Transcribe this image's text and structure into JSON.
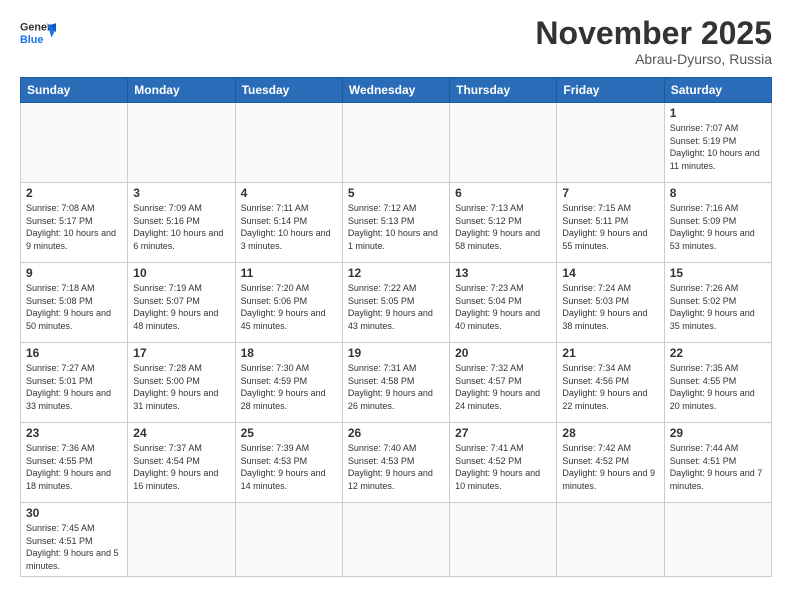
{
  "logo": {
    "general": "General",
    "blue": "Blue"
  },
  "header": {
    "month": "November 2025",
    "location": "Abrau-Dyurso, Russia"
  },
  "weekdays": [
    "Sunday",
    "Monday",
    "Tuesday",
    "Wednesday",
    "Thursday",
    "Friday",
    "Saturday"
  ],
  "weeks": [
    [
      {
        "day": "",
        "info": ""
      },
      {
        "day": "",
        "info": ""
      },
      {
        "day": "",
        "info": ""
      },
      {
        "day": "",
        "info": ""
      },
      {
        "day": "",
        "info": ""
      },
      {
        "day": "",
        "info": ""
      },
      {
        "day": "1",
        "info": "Sunrise: 7:07 AM\nSunset: 5:19 PM\nDaylight: 10 hours\nand 11 minutes."
      }
    ],
    [
      {
        "day": "2",
        "info": "Sunrise: 7:08 AM\nSunset: 5:17 PM\nDaylight: 10 hours\nand 9 minutes."
      },
      {
        "day": "3",
        "info": "Sunrise: 7:09 AM\nSunset: 5:16 PM\nDaylight: 10 hours\nand 6 minutes."
      },
      {
        "day": "4",
        "info": "Sunrise: 7:11 AM\nSunset: 5:14 PM\nDaylight: 10 hours\nand 3 minutes."
      },
      {
        "day": "5",
        "info": "Sunrise: 7:12 AM\nSunset: 5:13 PM\nDaylight: 10 hours\nand 1 minute."
      },
      {
        "day": "6",
        "info": "Sunrise: 7:13 AM\nSunset: 5:12 PM\nDaylight: 9 hours\nand 58 minutes."
      },
      {
        "day": "7",
        "info": "Sunrise: 7:15 AM\nSunset: 5:11 PM\nDaylight: 9 hours\nand 55 minutes."
      },
      {
        "day": "8",
        "info": "Sunrise: 7:16 AM\nSunset: 5:09 PM\nDaylight: 9 hours\nand 53 minutes."
      }
    ],
    [
      {
        "day": "9",
        "info": "Sunrise: 7:18 AM\nSunset: 5:08 PM\nDaylight: 9 hours\nand 50 minutes."
      },
      {
        "day": "10",
        "info": "Sunrise: 7:19 AM\nSunset: 5:07 PM\nDaylight: 9 hours\nand 48 minutes."
      },
      {
        "day": "11",
        "info": "Sunrise: 7:20 AM\nSunset: 5:06 PM\nDaylight: 9 hours\nand 45 minutes."
      },
      {
        "day": "12",
        "info": "Sunrise: 7:22 AM\nSunset: 5:05 PM\nDaylight: 9 hours\nand 43 minutes."
      },
      {
        "day": "13",
        "info": "Sunrise: 7:23 AM\nSunset: 5:04 PM\nDaylight: 9 hours\nand 40 minutes."
      },
      {
        "day": "14",
        "info": "Sunrise: 7:24 AM\nSunset: 5:03 PM\nDaylight: 9 hours\nand 38 minutes."
      },
      {
        "day": "15",
        "info": "Sunrise: 7:26 AM\nSunset: 5:02 PM\nDaylight: 9 hours\nand 35 minutes."
      }
    ],
    [
      {
        "day": "16",
        "info": "Sunrise: 7:27 AM\nSunset: 5:01 PM\nDaylight: 9 hours\nand 33 minutes."
      },
      {
        "day": "17",
        "info": "Sunrise: 7:28 AM\nSunset: 5:00 PM\nDaylight: 9 hours\nand 31 minutes."
      },
      {
        "day": "18",
        "info": "Sunrise: 7:30 AM\nSunset: 4:59 PM\nDaylight: 9 hours\nand 28 minutes."
      },
      {
        "day": "19",
        "info": "Sunrise: 7:31 AM\nSunset: 4:58 PM\nDaylight: 9 hours\nand 26 minutes."
      },
      {
        "day": "20",
        "info": "Sunrise: 7:32 AM\nSunset: 4:57 PM\nDaylight: 9 hours\nand 24 minutes."
      },
      {
        "day": "21",
        "info": "Sunrise: 7:34 AM\nSunset: 4:56 PM\nDaylight: 9 hours\nand 22 minutes."
      },
      {
        "day": "22",
        "info": "Sunrise: 7:35 AM\nSunset: 4:55 PM\nDaylight: 9 hours\nand 20 minutes."
      }
    ],
    [
      {
        "day": "23",
        "info": "Sunrise: 7:36 AM\nSunset: 4:55 PM\nDaylight: 9 hours\nand 18 minutes."
      },
      {
        "day": "24",
        "info": "Sunrise: 7:37 AM\nSunset: 4:54 PM\nDaylight: 9 hours\nand 16 minutes."
      },
      {
        "day": "25",
        "info": "Sunrise: 7:39 AM\nSunset: 4:53 PM\nDaylight: 9 hours\nand 14 minutes."
      },
      {
        "day": "26",
        "info": "Sunrise: 7:40 AM\nSunset: 4:53 PM\nDaylight: 9 hours\nand 12 minutes."
      },
      {
        "day": "27",
        "info": "Sunrise: 7:41 AM\nSunset: 4:52 PM\nDaylight: 9 hours\nand 10 minutes."
      },
      {
        "day": "28",
        "info": "Sunrise: 7:42 AM\nSunset: 4:52 PM\nDaylight: 9 hours\nand 9 minutes."
      },
      {
        "day": "29",
        "info": "Sunrise: 7:44 AM\nSunset: 4:51 PM\nDaylight: 9 hours\nand 7 minutes."
      }
    ],
    [
      {
        "day": "30",
        "info": "Sunrise: 7:45 AM\nSunset: 4:51 PM\nDaylight: 9 hours\nand 5 minutes."
      },
      {
        "day": "",
        "info": ""
      },
      {
        "day": "",
        "info": ""
      },
      {
        "day": "",
        "info": ""
      },
      {
        "day": "",
        "info": ""
      },
      {
        "day": "",
        "info": ""
      },
      {
        "day": "",
        "info": ""
      }
    ]
  ]
}
